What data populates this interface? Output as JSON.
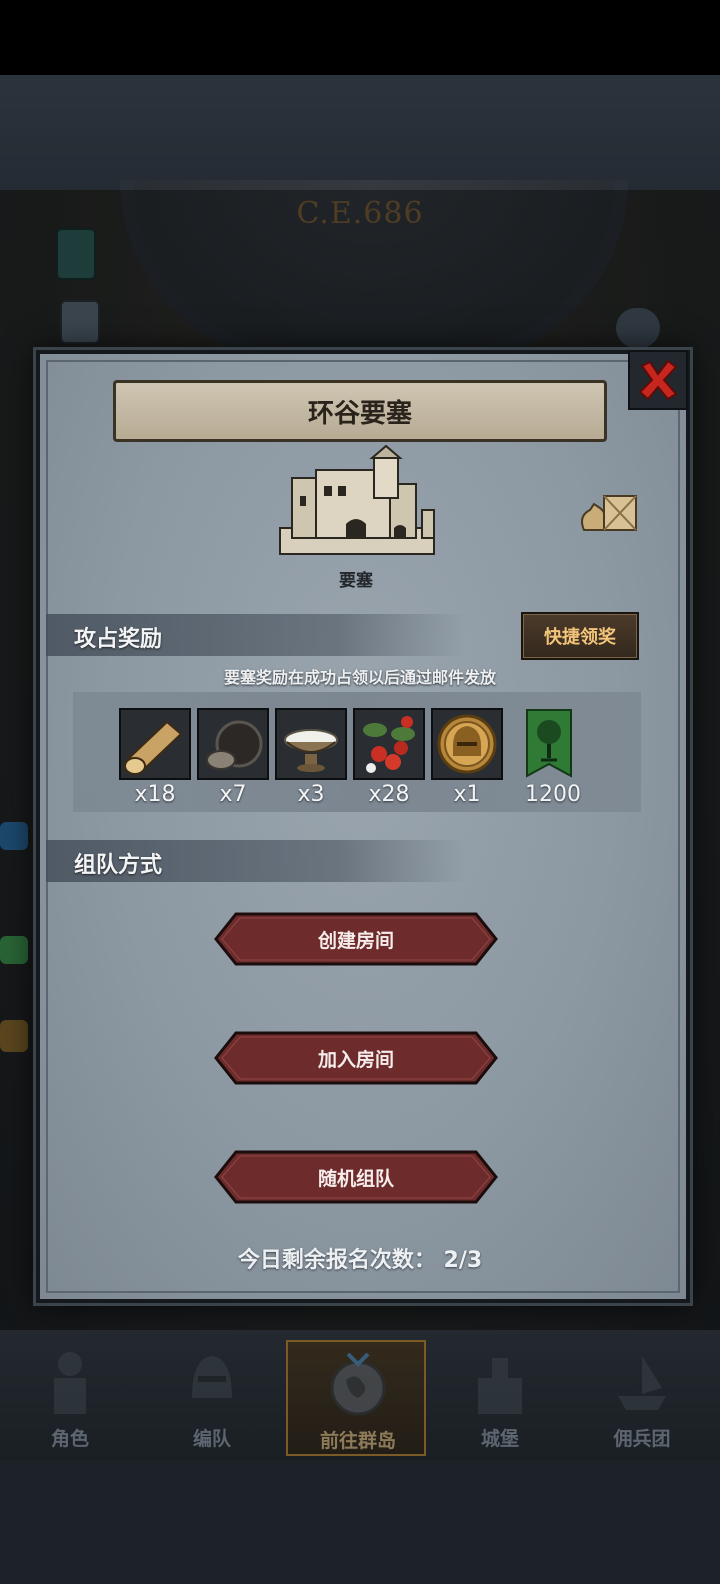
{
  "background": {
    "date": "C.E.686"
  },
  "dialog": {
    "title": "环谷要塞",
    "building_label": "要塞",
    "close_icon": "close-x-icon"
  },
  "rewards": {
    "section_title": "攻占奖励",
    "quick_claim_label": "快捷领奖",
    "note": "要塞奖励在成功占领以后通过邮件发放",
    "items": [
      {
        "icon": "wood-log-icon",
        "count": "x18"
      },
      {
        "icon": "truffle-icon",
        "count": "x7"
      },
      {
        "icon": "salt-bowl-icon",
        "count": "x3"
      },
      {
        "icon": "berries-icon",
        "count": "x28"
      },
      {
        "icon": "gold-helmet-coin-icon",
        "count": "x1"
      },
      {
        "icon": "tree-banner-icon",
        "count": "1200"
      }
    ]
  },
  "team": {
    "section_title": "组队方式",
    "buttons": {
      "create": "创建房间",
      "join": "加入房间",
      "random": "随机组队"
    }
  },
  "signups": {
    "label": "今日剩余报名次数：",
    "value": "2/3"
  },
  "nav": {
    "items": [
      {
        "label": "角色",
        "icon": "knight-icon"
      },
      {
        "label": "编队",
        "icon": "helmet-icon"
      },
      {
        "label": "前往群岛",
        "icon": "globe-icon",
        "active": true
      },
      {
        "label": "城堡",
        "icon": "castle-icon"
      },
      {
        "label": "佣兵团",
        "icon": "ship-icon"
      }
    ]
  },
  "colors": {
    "accent_gold": "#f3c57b",
    "button_red": "#6e2b2b",
    "panel": "#8c98a2"
  }
}
